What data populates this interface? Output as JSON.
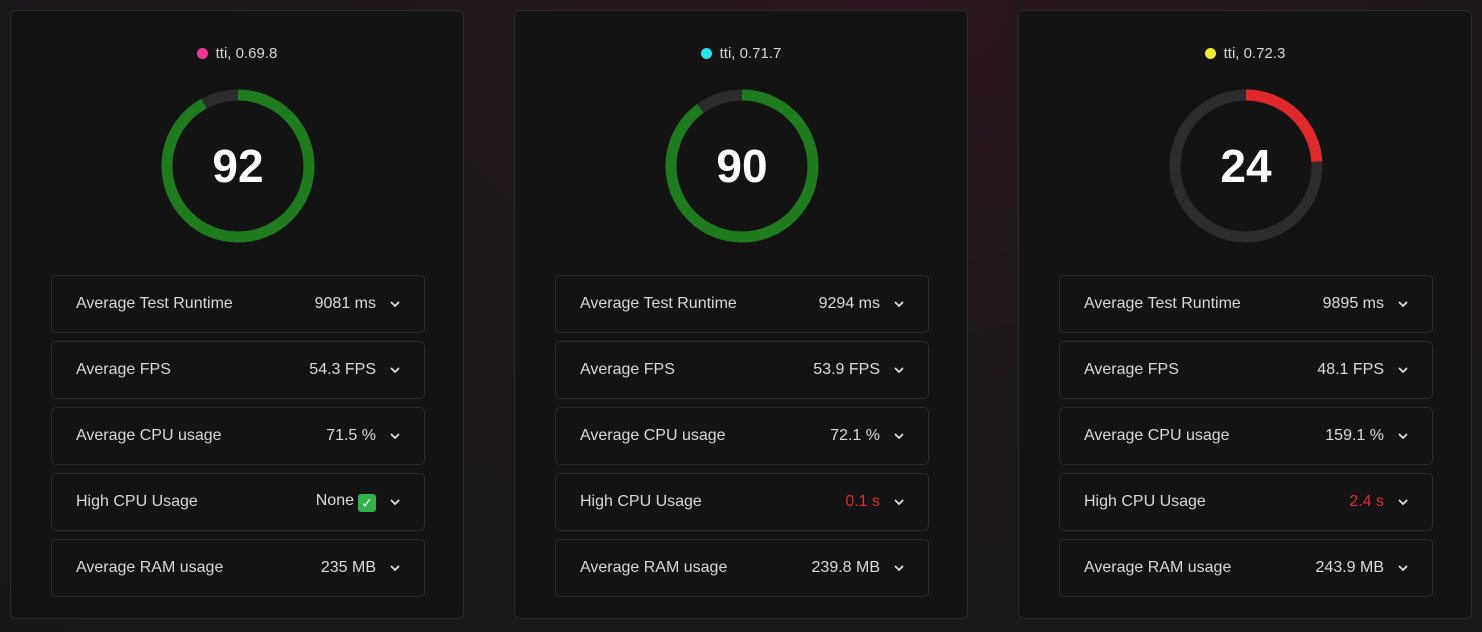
{
  "cards": [
    {
      "title": "tti, 0.69.8",
      "dot_color": "#f0369b",
      "score": "92",
      "score_fraction": 0.92,
      "ring_color": "#1e7b1e",
      "metrics": [
        {
          "label": "Average Test Runtime",
          "value": "9081 ms",
          "status": "normal"
        },
        {
          "label": "Average FPS",
          "value": "54.3 FPS",
          "status": "normal"
        },
        {
          "label": "Average CPU usage",
          "value": "71.5 %",
          "status": "normal"
        },
        {
          "label": "High CPU Usage",
          "value": "None",
          "status": "ok",
          "icon": "check-mark-icon"
        },
        {
          "label": "Average RAM usage",
          "value": "235 MB",
          "status": "normal"
        }
      ]
    },
    {
      "title": "tti, 0.71.7",
      "dot_color": "#27e3ea",
      "score": "90",
      "score_fraction": 0.9,
      "ring_color": "#1e7b1e",
      "metrics": [
        {
          "label": "Average Test Runtime",
          "value": "9294 ms",
          "status": "normal"
        },
        {
          "label": "Average FPS",
          "value": "53.9 FPS",
          "status": "normal"
        },
        {
          "label": "Average CPU usage",
          "value": "72.1 %",
          "status": "normal"
        },
        {
          "label": "High CPU Usage",
          "value": "0.1 s",
          "status": "bad"
        },
        {
          "label": "Average RAM usage",
          "value": "239.8 MB",
          "status": "normal"
        }
      ]
    },
    {
      "title": "tti, 0.72.3",
      "dot_color": "#f2e935",
      "score": "24",
      "score_fraction": 0.24,
      "ring_color": "#e0282d",
      "metrics": [
        {
          "label": "Average Test Runtime",
          "value": "9895 ms",
          "status": "normal"
        },
        {
          "label": "Average FPS",
          "value": "48.1 FPS",
          "status": "normal"
        },
        {
          "label": "Average CPU usage",
          "value": "159.1 %",
          "status": "normal"
        },
        {
          "label": "High CPU Usage",
          "value": "2.4 s",
          "status": "bad"
        },
        {
          "label": "Average RAM usage",
          "value": "243.9 MB",
          "status": "normal"
        }
      ]
    }
  ],
  "colors": {
    "ring_track": "#2c2c2c",
    "bad_value": "#e22b2b",
    "card_background": "#131313"
  }
}
